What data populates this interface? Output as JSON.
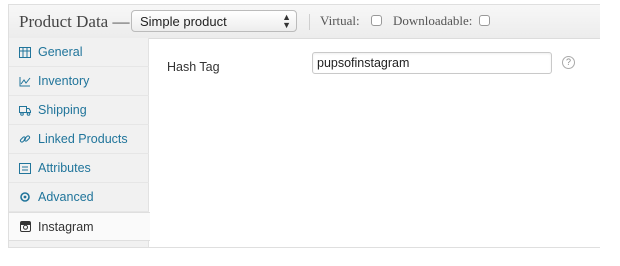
{
  "header": {
    "title": "Product Data —",
    "product_type_select": {
      "selected": "Simple product"
    },
    "virtual_label": "Virtual:",
    "downloadable_label": "Downloadable:"
  },
  "sidebar": {
    "items": [
      {
        "label": "General",
        "icon": "grid-icon"
      },
      {
        "label": "Inventory",
        "icon": "chart-icon"
      },
      {
        "label": "Shipping",
        "icon": "truck-icon"
      },
      {
        "label": "Linked Products",
        "icon": "link-icon"
      },
      {
        "label": "Attributes",
        "icon": "list-icon"
      },
      {
        "label": "Advanced",
        "icon": "gear-icon"
      },
      {
        "label": "Instagram",
        "icon": "camera-icon",
        "active": true
      }
    ]
  },
  "main": {
    "hash_tag_label": "Hash Tag",
    "hash_tag_value": "pupsofinstagram",
    "help_glyph": "?"
  },
  "colors": {
    "link": "#21759b",
    "sidebar_bg": "#f1f1f1",
    "header_bg": "#ececec"
  }
}
